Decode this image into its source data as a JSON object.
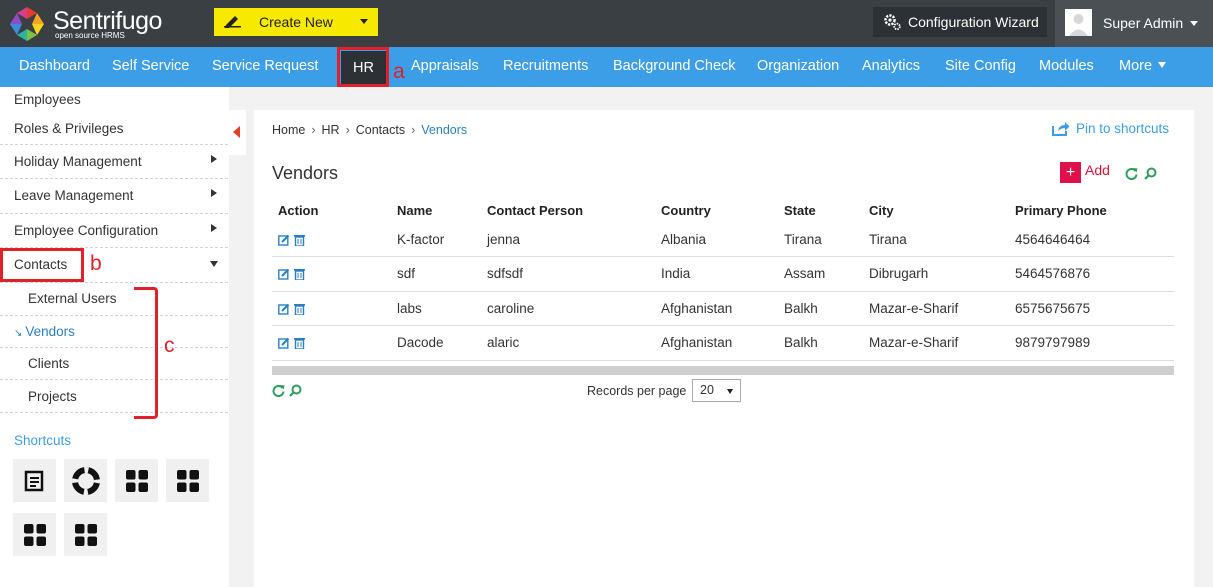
{
  "app": {
    "name": "Sentrifugo",
    "tagline": "open source HRMS"
  },
  "topbar": {
    "create_new_label": "Create New",
    "config_wizard_label": "Configuration Wizard",
    "user_name": "Super Admin"
  },
  "nav": {
    "items": [
      "Dashboard",
      "Self Service",
      "Service Request",
      "HR",
      "Appraisals",
      "Recruitments",
      "Background Check",
      "Organization",
      "Analytics",
      "Site Config",
      "Modules",
      "More"
    ],
    "active": "HR"
  },
  "annotations": {
    "a": "a",
    "b": "b",
    "c": "c"
  },
  "sidebar": {
    "items": [
      "Employees",
      "Roles & Privileges",
      "Holiday Management",
      "Leave Management",
      "Employee Configuration",
      "Contacts"
    ],
    "contacts_sub": [
      "External Users",
      "Vendors",
      "Clients",
      "Projects"
    ],
    "active_sub": "Vendors",
    "shortcuts_title": "Shortcuts"
  },
  "breadcrumb": [
    "Home",
    "HR",
    "Contacts",
    "Vendors"
  ],
  "pin_label": "Pin to shortcuts",
  "page": {
    "title": "Vendors",
    "add_label": "Add"
  },
  "table": {
    "columns": [
      "Action",
      "Name",
      "Contact Person",
      "Country",
      "State",
      "City",
      "Primary Phone"
    ],
    "rows": [
      [
        "K-factor",
        "jenna",
        "Albania",
        "Tirana",
        "Tirana",
        "4564646464"
      ],
      [
        "sdf",
        "sdfsdf",
        "India",
        "Assam",
        "Dibrugarh",
        "5464576876"
      ],
      [
        "labs",
        "caroline",
        "Afghanistan",
        "Balkh",
        "Mazar-e-Sharif",
        "6575675675"
      ],
      [
        "Dacode",
        "alaric",
        "Afghanistan",
        "Balkh",
        "Mazar-e-Sharif",
        "9879797989"
      ]
    ]
  },
  "pagination": {
    "records_per_page_label": "Records per page",
    "records_per_page": "20"
  },
  "colors": {
    "nav_blue": "#3c9ee6",
    "topbar_dark": "#3a3f44",
    "create_yellow": "#f7ea00",
    "accent_red": "#e0104a",
    "annotation_red": "#e0202a"
  }
}
